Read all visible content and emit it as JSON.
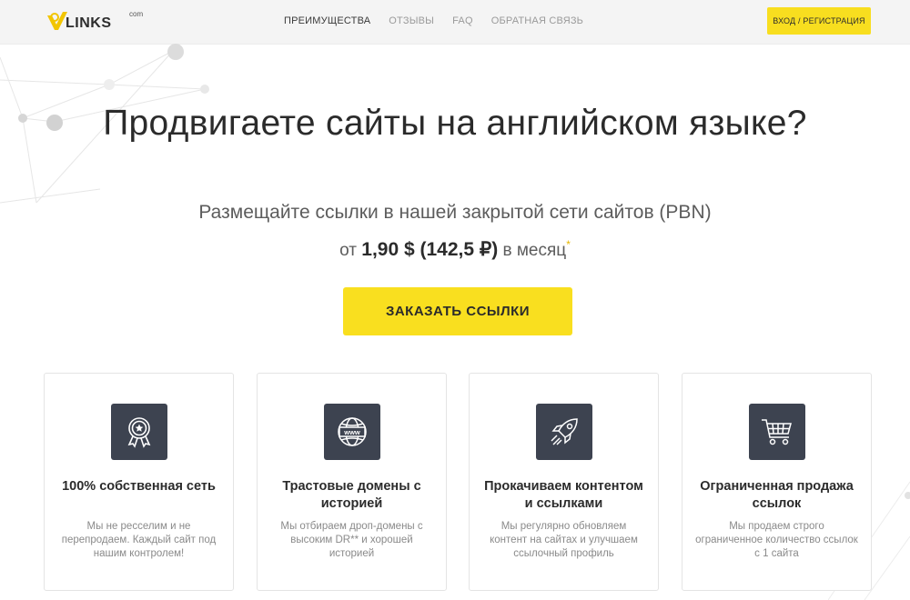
{
  "header": {
    "logo_text": "LINKS",
    "logo_sup": "com",
    "nav": [
      "ПРЕИМУЩЕСТВА",
      "ОТЗЫВЫ",
      "FAQ",
      "ОБРАТНАЯ СВЯЗЬ"
    ],
    "login_label": "ВХОД / РЕГИСТРАЦИЯ"
  },
  "hero": {
    "title": "Продвигаете сайты на английском языке?",
    "subtitle": "Размещайте ссылки в нашей закрытой сети сайтов (PBN)",
    "price_prefix": "от",
    "price_value": "1,90 $ (142,5 ₽)",
    "price_suffix": "в месяц",
    "price_asterisk": "*",
    "cta_label": "ЗАКАЗАТЬ ССЫЛКИ"
  },
  "features": [
    {
      "icon": "award-badge-icon",
      "title": "100% собственная сеть",
      "text": "Мы не ресселим и не перепродаем. Каждый сайт под нашим контролем!"
    },
    {
      "icon": "www-globe-icon",
      "title": "Трастовые домены с историей",
      "text": "Мы отбираем дроп-домены с высоким DR** и хорошей историей"
    },
    {
      "icon": "rocket-icon",
      "title": "Прокачиваем контентом и ссылками",
      "text": "Мы регулярно обновляем контент на сайтах и улучшаем ссылочный профиль"
    },
    {
      "icon": "shopping-cart-icon",
      "title": "Ограниченная продажа ссылок",
      "text": "Мы продаем строго ограниченное количество ссылок с 1 сайта"
    }
  ],
  "colors": {
    "accent": "#f9df1f",
    "icon_bg": "#3d4350",
    "text_dark": "#2b2b2b"
  }
}
